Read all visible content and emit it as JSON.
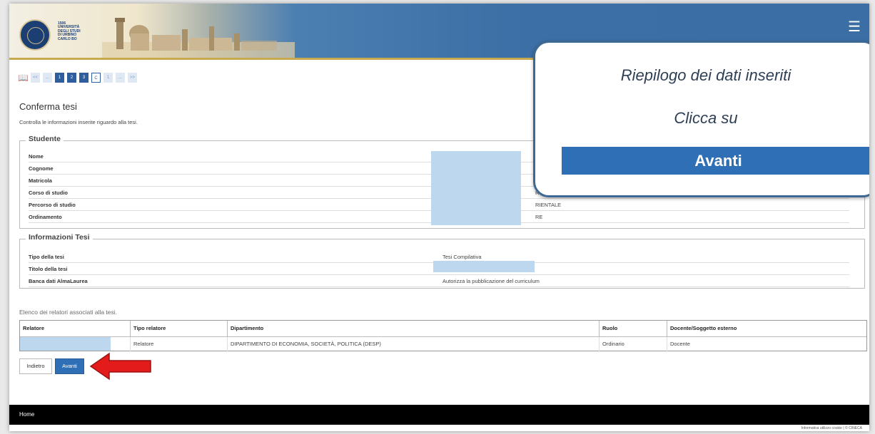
{
  "header": {
    "logo_text": "1506\nUNIVERSITÀ\nDEGLI STUDI\nDI URBINO\nCARLO BO",
    "menu_icon": "hamburger-icon"
  },
  "pager": {
    "book_icon": "book-icon",
    "items": [
      "<<",
      "...",
      "1",
      "2",
      "3",
      "C",
      "1",
      "...",
      ">>"
    ]
  },
  "page": {
    "title": "Conferma tesi",
    "subtitle": "Controlla le informazioni inserite riguardo alla tesi."
  },
  "studente": {
    "legend": "Studente",
    "rows": [
      {
        "label": "Nome",
        "value": ""
      },
      {
        "label": "Cognome",
        "value": ""
      },
      {
        "label": "Matricola",
        "value": ""
      },
      {
        "label": "Corso di studio",
        "value": "RE"
      },
      {
        "label": "Percorso di studio",
        "value": "RIENTALE"
      },
      {
        "label": "Ordinamento",
        "value": "RE"
      }
    ]
  },
  "tesi": {
    "legend": "Informazioni Tesi",
    "rows": [
      {
        "label": "Tipo della tesi",
        "value": "Tesi Compilativa"
      },
      {
        "label": "Titolo della tesi",
        "value": ""
      },
      {
        "label": "Banca dati AlmaLaurea",
        "value": "Autorizza la pubblicazione del curriculum"
      }
    ]
  },
  "callout": {
    "line1": "Riepilogo dei dati inseriti",
    "line2": "Clicca su",
    "button": "Avanti"
  },
  "relatori": {
    "title": "Elenco dei relatori associati alla tesi.",
    "headers": [
      "Relatore",
      "Tipo relatore",
      "Dipartimento",
      "Ruolo",
      "Docente/Soggetto esterno"
    ],
    "row": [
      "",
      "Relatore",
      "DIPARTIMENTO DI ECONOMIA, SOCIETÀ, POLITICA (DESP)",
      "Ordinario",
      "Docente"
    ]
  },
  "buttons": {
    "back": "Indietro",
    "next": "Avanti"
  },
  "footer": {
    "home": "Home",
    "bottom": "Informativa utilizzo cookie | © CINECA"
  },
  "colors": {
    "header_blue": "#3b6fa5",
    "accent_blue": "#2f6fb6",
    "arrow_red": "#e31b1b",
    "redaction": "#bdd7ee"
  }
}
